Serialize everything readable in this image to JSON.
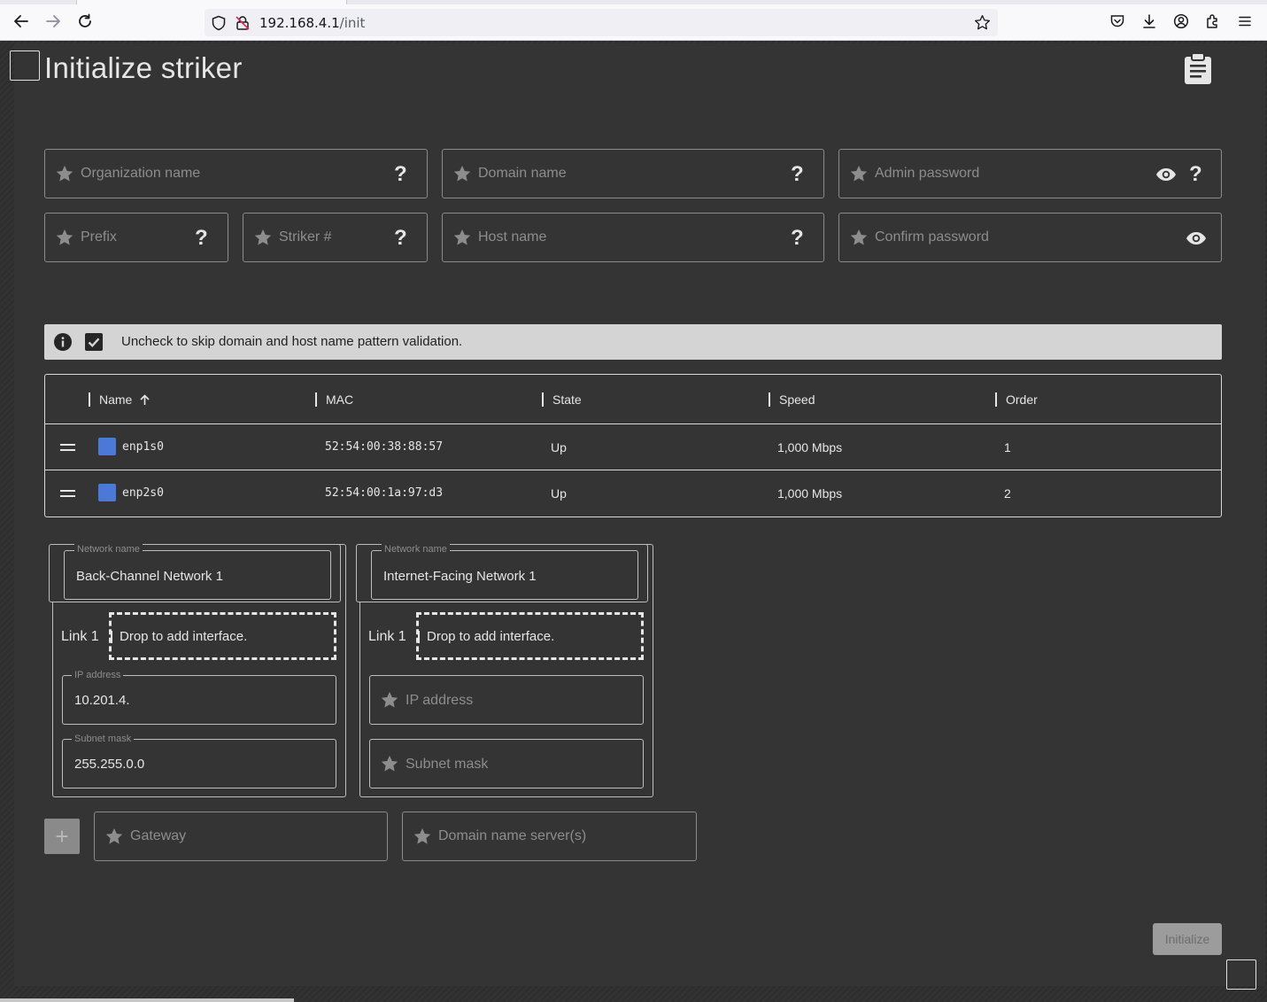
{
  "browser": {
    "url_host": "192.168.4.1",
    "url_path": "/init"
  },
  "page": {
    "title": "Initialize striker"
  },
  "fields": {
    "organization_name": "Organization name",
    "domain_name": "Domain name",
    "admin_password": "Admin password",
    "prefix": "Prefix",
    "striker_number": "Striker #",
    "host_name": "Host name",
    "confirm_password": "Confirm password",
    "help_glyph": "?"
  },
  "validation": {
    "message": "Uncheck to skip domain and host name pattern validation.",
    "checked": true
  },
  "interfaces": {
    "columns": [
      "Name",
      "MAC",
      "State",
      "Speed",
      "Order"
    ],
    "rows": [
      {
        "name": "enp1s0",
        "mac": "52:54:00:38:88:57",
        "state": "Up",
        "speed": "1,000 Mbps",
        "order": "1"
      },
      {
        "name": "enp2s0",
        "mac": "52:54:00:1a:97:d3",
        "state": "Up",
        "speed": "1,000 Mbps",
        "order": "2"
      }
    ]
  },
  "networks": [
    {
      "legend": "Network name",
      "name": "Back-Channel Network 1",
      "link_label": "Link 1",
      "drop_text": "Drop to add interface.",
      "ip_legend": "IP address",
      "ip_value": "10.201.4.",
      "mask_legend": "Subnet mask",
      "mask_value": "255.255.0.0"
    },
    {
      "legend": "Network name",
      "name": "Internet-Facing Network 1",
      "link_label": "Link 1",
      "drop_text": "Drop to add interface.",
      "ip_placeholder": "IP address",
      "mask_placeholder": "Subnet mask"
    }
  ],
  "gateway": {
    "placeholder": "Gateway"
  },
  "dns": {
    "placeholder": "Domain name server(s)"
  },
  "actions": {
    "add_glyph": "+",
    "initialize_label": "Initialize"
  },
  "icons": {
    "back": "back-arrow-icon",
    "forward": "forward-arrow-icon",
    "reload": "reload-icon",
    "shield": "shield-icon",
    "insecure": "insecure-lock-icon",
    "bookmark": "star-outline-icon",
    "pocket": "pocket-icon",
    "download": "download-icon",
    "account": "account-icon",
    "extensions": "extensions-icon",
    "menu": "menu-icon",
    "clipboard": "clipboard-icon",
    "required": "star-icon",
    "visibility": "eye-icon",
    "info": "info-icon",
    "sort_ascending": "arrow-up-icon",
    "drag_handle": "drag-handle-icon"
  },
  "colors": {
    "interface_square": "#4c79d8",
    "page_background": "#343434",
    "info_bar": "#d4d4d4"
  }
}
